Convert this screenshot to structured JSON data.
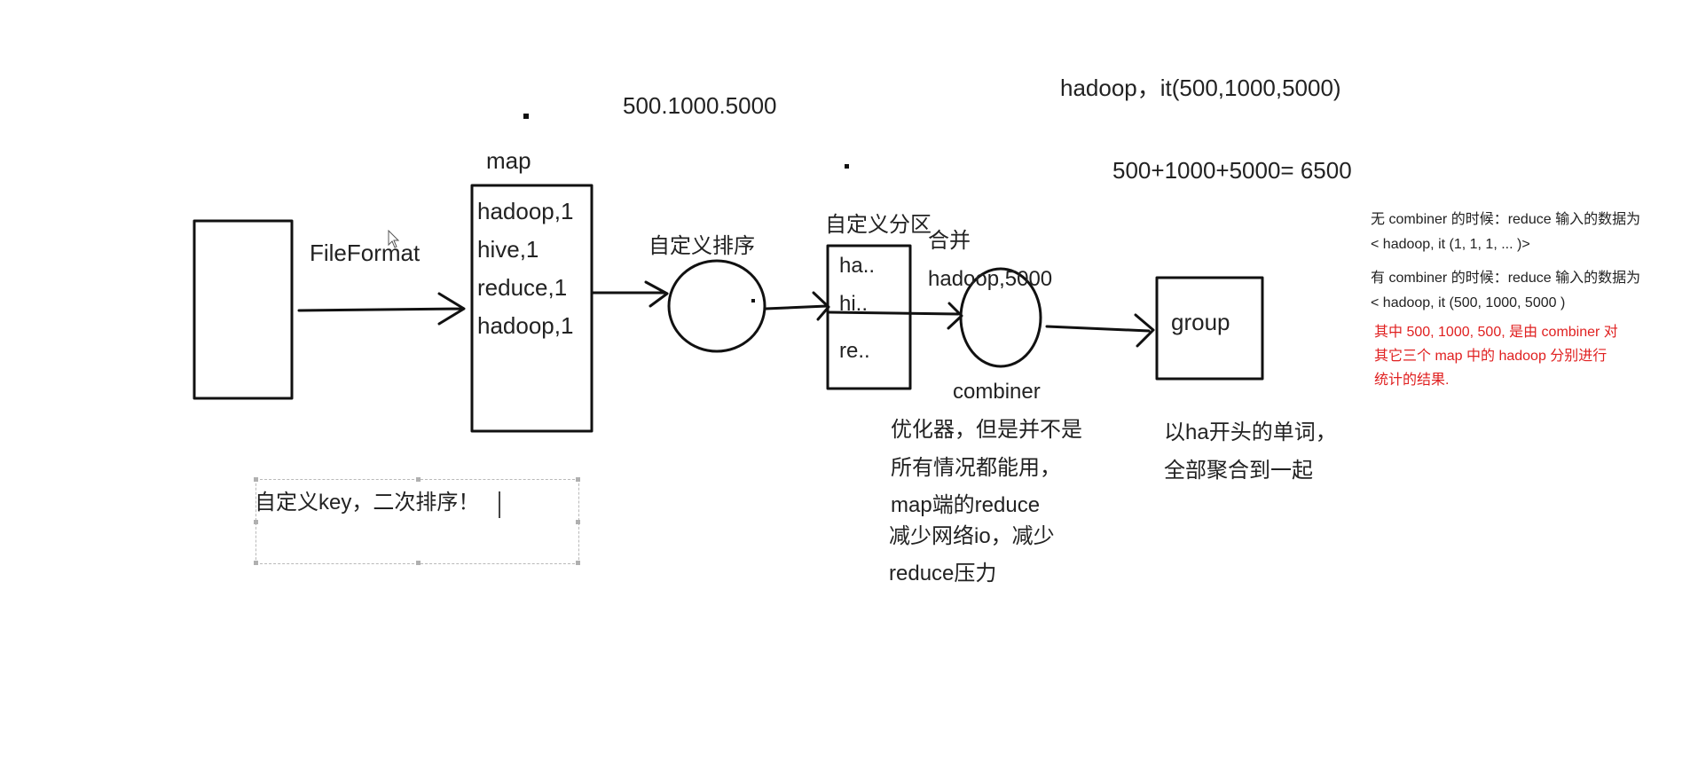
{
  "labels": {
    "top_values": "500.1000.5000",
    "top_hadoop": "hadoop，it(500,1000,5000)",
    "sum": "500+1000+5000= 6500",
    "map": "map",
    "fileformat": "FileFormat",
    "map_lines": [
      "hadoop,1",
      "hive,1",
      "reduce,1",
      "hadoop,1"
    ],
    "sort": "自定义排序",
    "partition": "自定义分区",
    "partition_items": [
      "ha..",
      "hi..",
      "re.."
    ],
    "merge": "合并",
    "merge_value": "hadoop,5000",
    "combiner": "combiner",
    "combiner_notes": [
      "优化器，但是并不是",
      "所有情况都能用，",
      "map端的reduce",
      "减少网络io，减少",
      "reduce压力"
    ],
    "group": "group",
    "group_notes": [
      "以ha开头的单词，",
      "全部聚合到一起"
    ],
    "textbox": "自定义key，二次排序！"
  },
  "notes": {
    "no_combiner_1": "无 combiner 的时候：reduce 输入的数据为",
    "no_combiner_2": "< hadoop, it (1, 1, 1, ... )>",
    "with_combiner_1": "有 combiner 的时候：reduce 输入的数据为",
    "with_combiner_2": "< hadoop, it (500, 1000, 5000 )",
    "red_1": "其中 500, 1000, 500, 是由 combiner 对",
    "red_2": "其它三个 map 中的 hadoop 分别进行",
    "red_3": "统计的结果."
  },
  "colors": {
    "ink": "#111111",
    "note_red": "#e02020",
    "textbox_border": "#b9b9b9"
  },
  "icons": {
    "cursor": "mouse-pointer-icon"
  }
}
